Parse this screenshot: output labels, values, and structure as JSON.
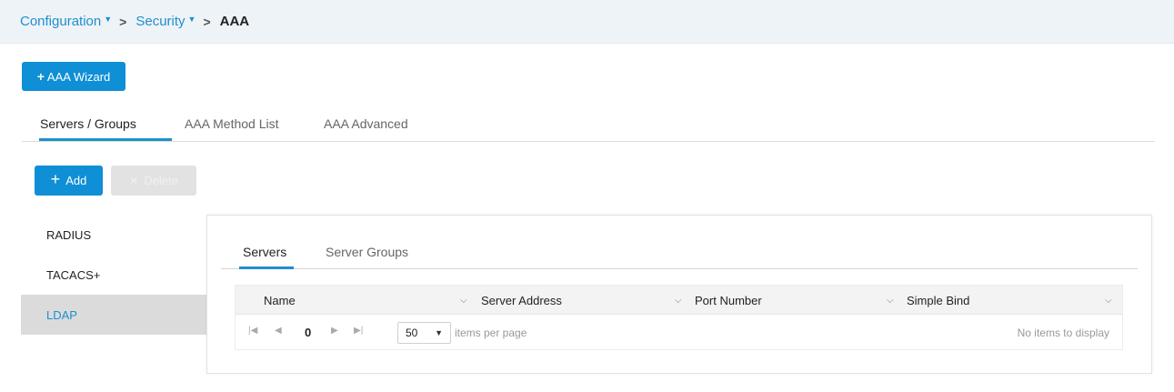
{
  "breadcrumb": {
    "items": [
      {
        "label": "Configuration",
        "caret": "▼"
      },
      {
        "label": "Security",
        "caret": "▼"
      }
    ],
    "separator": ">",
    "current": "AAA"
  },
  "wizard_button": {
    "plus": "+",
    "label": "AAA Wizard"
  },
  "main_tabs": [
    "Servers / Groups",
    "AAA Method List",
    "AAA Advanced"
  ],
  "actions": {
    "add": {
      "plus": "+",
      "label": "Add"
    },
    "delete": {
      "x": "✕",
      "label": "Delete"
    }
  },
  "side_list": [
    "RADIUS",
    "TACACS+",
    "LDAP"
  ],
  "sub_tabs": [
    "Servers",
    "Server Groups"
  ],
  "table": {
    "columns": [
      "Name",
      "Server Address",
      "Port Number",
      "Simple Bind"
    ],
    "caret": "⌵"
  },
  "pager": {
    "first": "|◀",
    "prev": "◀",
    "page": "0",
    "next": "▶",
    "last": "▶|",
    "per_page": "50",
    "per_page_caret": "▼",
    "per_page_label": "items per page",
    "empty_text": "No items to display"
  },
  "colors": {
    "accent": "#0f8fd5",
    "link": "#1f8ecf",
    "selected_bg": "#dbdbdb",
    "header_bg": "#eef3f7"
  }
}
